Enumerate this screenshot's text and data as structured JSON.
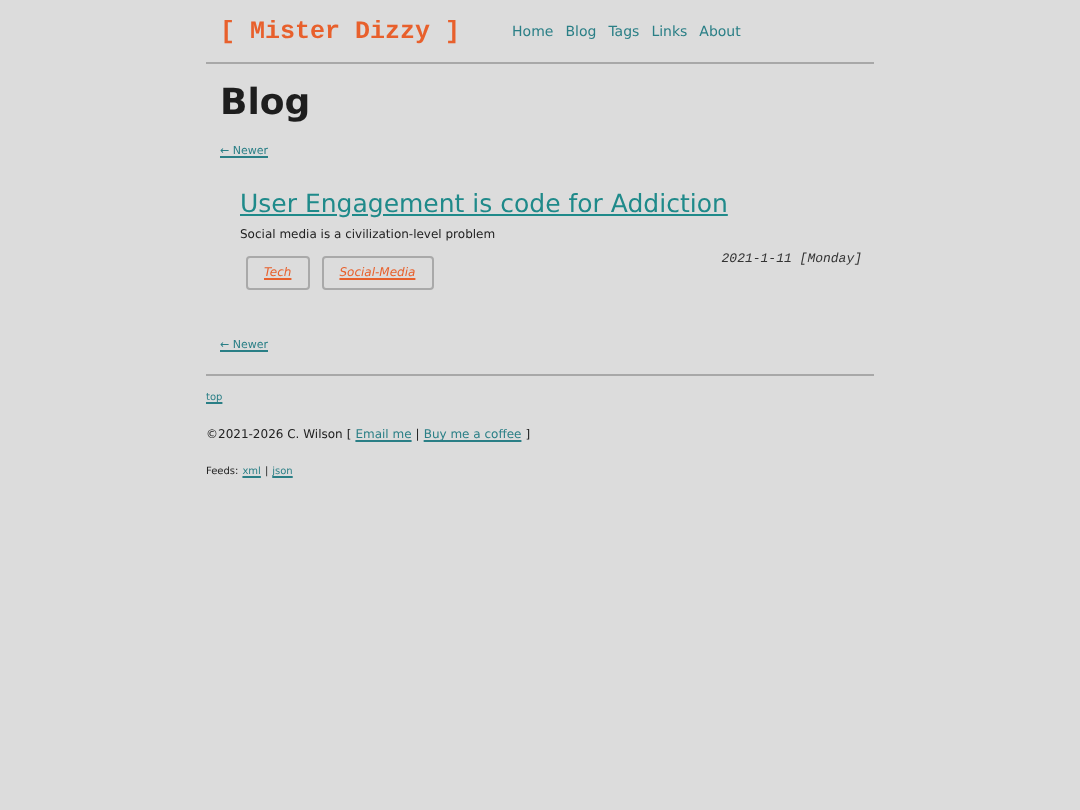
{
  "header": {
    "logo": "[ Mister Dizzy ]",
    "nav": [
      "Home",
      "Blog",
      "Tags",
      "Links",
      "About"
    ]
  },
  "heading": "Blog",
  "newer_top": "← Newer",
  "post": {
    "title": "User Engagement is code for Addiction",
    "summary": "Social media is a civilization-level problem",
    "tags": [
      "Tech",
      "Social-Media"
    ],
    "date": "2021-1-11 [Monday]"
  },
  "newer_bottom": "← Newer",
  "footer": {
    "top_link": "top",
    "copyright": [
      {
        "kind": "text",
        "text": "©2021-2026 C. Wilson"
      },
      {
        "kind": "text",
        "text": "["
      },
      {
        "kind": "link",
        "text": "Email me"
      },
      {
        "kind": "text",
        "text": "|"
      },
      {
        "kind": "link",
        "text": "Buy me a coffee"
      },
      {
        "kind": "text",
        "text": "]"
      }
    ],
    "feeds": [
      {
        "kind": "text",
        "text": "Feeds:"
      },
      {
        "kind": "link",
        "text": "xml"
      },
      {
        "kind": "text",
        "text": "|"
      },
      {
        "kind": "link",
        "text": "json"
      }
    ]
  }
}
